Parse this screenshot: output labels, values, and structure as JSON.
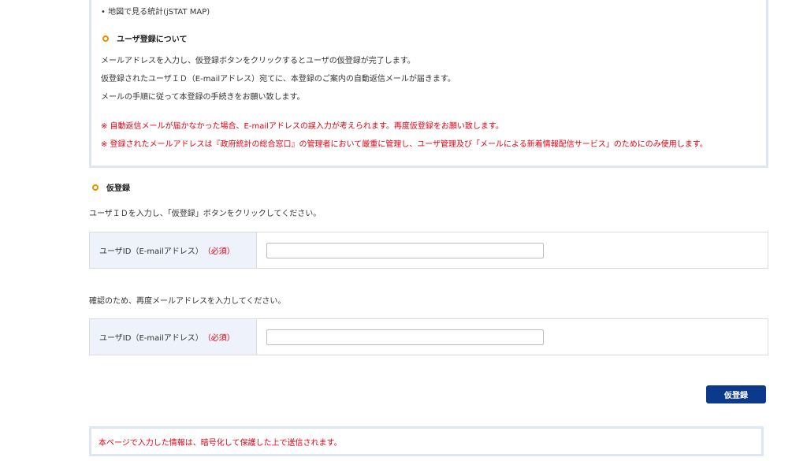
{
  "top_box": {
    "bullet_item": "• 地図で見る統計(jSTAT MAP)",
    "heading": "ユーザ登録について",
    "lines": [
      "メールアドレスを入力し、仮登録ボタンをクリックするとユーザの仮登録が完了します。",
      "仮登録されたユーザＩＤ（E-mailアドレス）宛てに、本登録のご案内の自動返信メールが届きます。",
      "メールの手順に従って本登録の手続きをお願い致します。"
    ],
    "notes": [
      "※ 自動返信メールが届かなかった場合、E-mailアドレスの誤入力が考えられます。再度仮登録をお願い致します。",
      "※ 登録されたメールアドレスは『政府統計の総合窓口』の管理者において厳重に管理し、ユーザ管理及び「メールによる新着情報配信サービス」のためにのみ使用します。"
    ]
  },
  "registration": {
    "heading": "仮登録",
    "instruction": "ユーザＩＤを入力し、「仮登録」ボタンをクリックしてください。",
    "confirm_instruction": "確認のため、再度メールアドレスを入力してください。",
    "field_label": "ユーザID（E-mailアドレス）",
    "required_mark": "（必須）",
    "email_value": "",
    "confirm_value": "",
    "submit_label": "仮登録"
  },
  "footer_notice": "本ページで入力した情報は、暗号化して保護した上で送信されます。",
  "colors": {
    "accent": "#f08c00",
    "button": "#0b3a8c",
    "warning": "#e60012",
    "box_border": "#dde6f5"
  }
}
